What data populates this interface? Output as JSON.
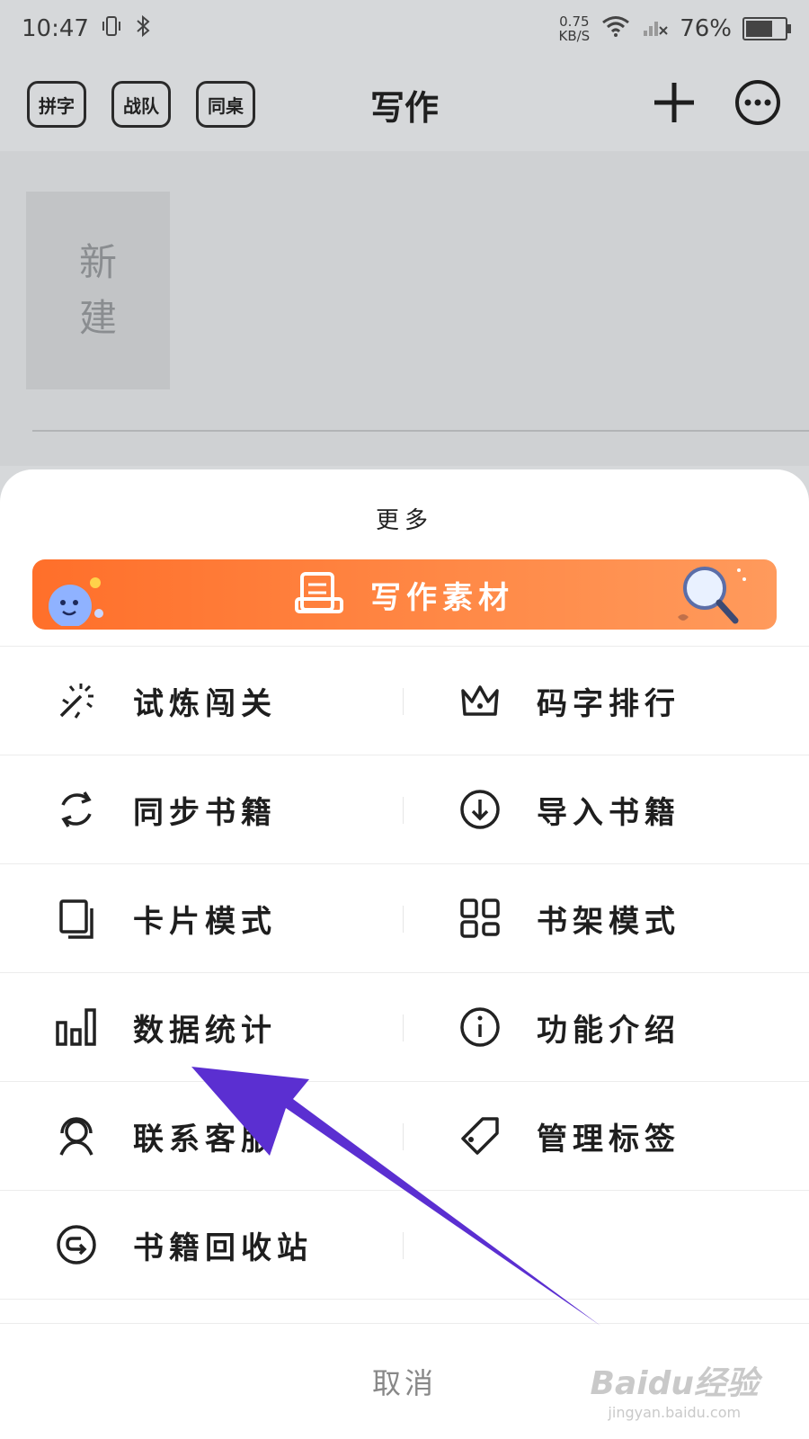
{
  "status_bar": {
    "time": "10:47",
    "net_speed_value": "0.75",
    "net_speed_unit": "KB/S",
    "battery": "76%",
    "battery_level": 0.76
  },
  "header": {
    "pills": [
      "拼字",
      "战队",
      "同桌"
    ],
    "title": "写作",
    "icons": [
      "plus-icon",
      "more-icon"
    ]
  },
  "content": {
    "new_card_line1": "新",
    "new_card_line2": "建"
  },
  "sheet": {
    "title": "更多",
    "banner_label": "写作素材",
    "menu": [
      [
        {
          "label": "试炼闯关",
          "icon": "sparkle-icon"
        },
        {
          "label": "码字排行",
          "icon": "crown-icon"
        }
      ],
      [
        {
          "label": "同步书籍",
          "icon": "sync-icon"
        },
        {
          "label": "导入书籍",
          "icon": "download-icon"
        }
      ],
      [
        {
          "label": "卡片模式",
          "icon": "card-icon"
        },
        {
          "label": "书架模式",
          "icon": "grid-icon"
        }
      ],
      [
        {
          "label": "数据统计",
          "icon": "bar-chart-icon"
        },
        {
          "label": "功能介绍",
          "icon": "info-icon"
        }
      ],
      [
        {
          "label": "联系客服",
          "icon": "support-icon"
        },
        {
          "label": "管理标签",
          "icon": "tag-icon"
        }
      ],
      [
        {
          "label": "书籍回收站",
          "icon": "recycle-icon"
        }
      ]
    ],
    "cancel": "取消"
  },
  "watermark": {
    "brand": "Baidu经验",
    "url": "jingyan.baidu.com"
  },
  "colors": {
    "banner_start": "#ff6f2a",
    "banner_end": "#ff9a5c",
    "arrow": "#5b2fd1",
    "overlay": "#d6d8da"
  }
}
